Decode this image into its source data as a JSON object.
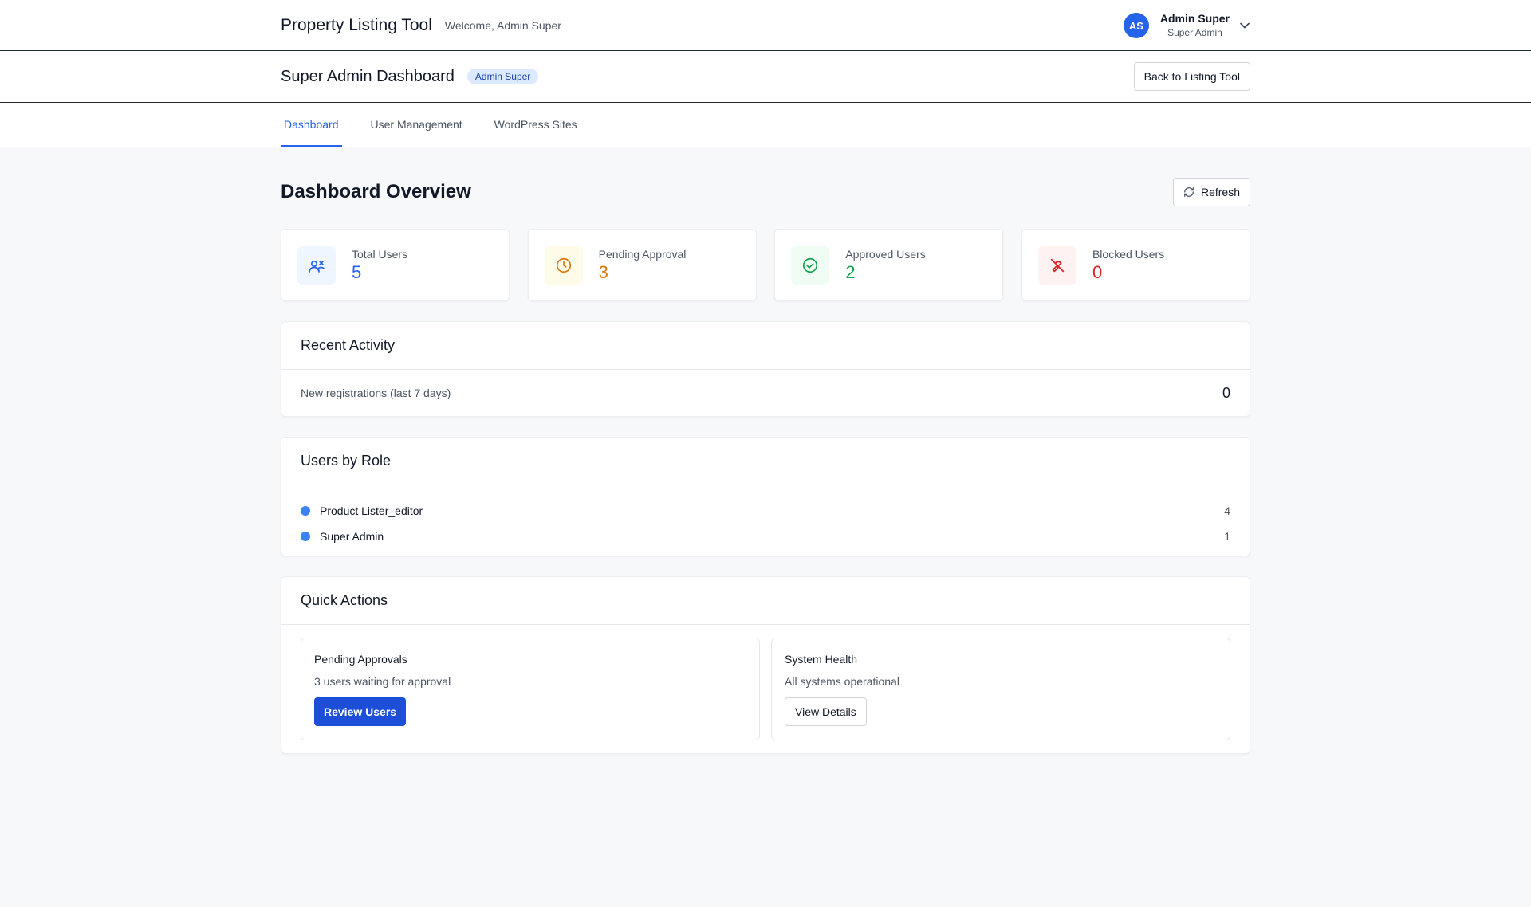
{
  "header": {
    "app_title": "Property Listing Tool",
    "welcome": "Welcome, Admin Super",
    "user": {
      "initials": "AS",
      "name": "Admin Super",
      "role": "Super Admin"
    }
  },
  "subheader": {
    "title": "Super Admin Dashboard",
    "badge": "Admin Super",
    "back_button": "Back to Listing Tool"
  },
  "tabs": [
    {
      "label": "Dashboard",
      "active": true
    },
    {
      "label": "User Management",
      "active": false
    },
    {
      "label": "WordPress Sites",
      "active": false
    }
  ],
  "overview": {
    "title": "Dashboard Overview",
    "refresh_label": "Refresh"
  },
  "stats": [
    {
      "label": "Total Users",
      "value": "5",
      "color": "#2563eb",
      "bg": "#eff6ff",
      "icon": "users-icon"
    },
    {
      "label": "Pending Approval",
      "value": "3",
      "color": "#d97706",
      "bg": "#fefce8",
      "icon": "clock-icon"
    },
    {
      "label": "Approved Users",
      "value": "2",
      "color": "#16a34a",
      "bg": "#f0fdf4",
      "icon": "check-circle-icon"
    },
    {
      "label": "Blocked Users",
      "value": "0",
      "color": "#dc2626",
      "bg": "#fef2f2",
      "icon": "blocked-icon"
    }
  ],
  "recent_activity": {
    "title": "Recent Activity",
    "rows": [
      {
        "label": "New registrations (last 7 days)",
        "value": "0"
      }
    ]
  },
  "users_by_role": {
    "title": "Users by Role",
    "roles": [
      {
        "name": "Product Lister_editor",
        "count": "4"
      },
      {
        "name": "Super Admin",
        "count": "1"
      }
    ]
  },
  "quick_actions": {
    "title": "Quick Actions",
    "cards": [
      {
        "title": "Pending Approvals",
        "description": "3 users waiting for approval",
        "button": "Review Users"
      },
      {
        "title": "System Health",
        "description": "All systems operational",
        "button": "View Details"
      }
    ]
  }
}
